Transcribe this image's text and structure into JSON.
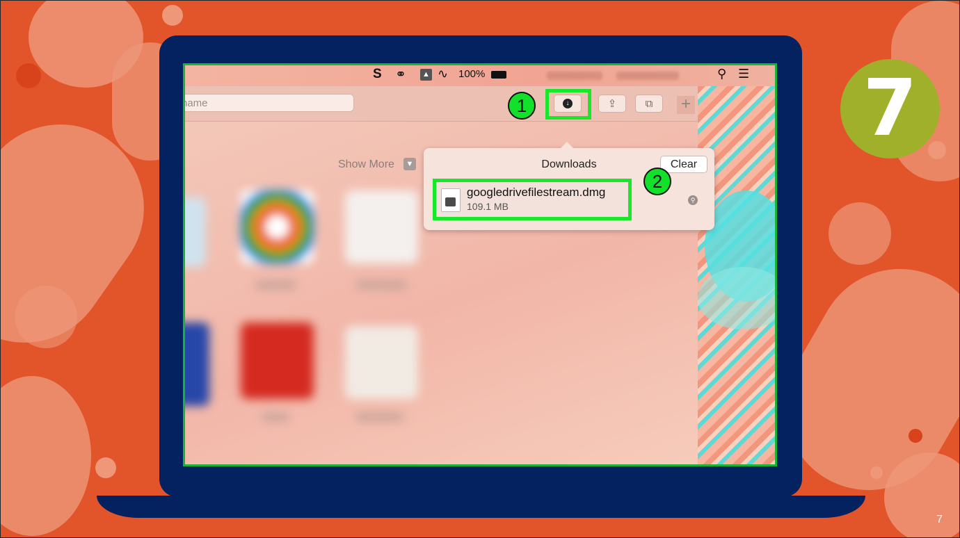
{
  "slide": {
    "step_number": "7",
    "page_number": "7",
    "colors": {
      "background": "#e2542a",
      "laptop": "#03225f",
      "highlight": "#17e82a",
      "step_badge": "#a0b02a"
    }
  },
  "menubar": {
    "icons": [
      "scribble-s-icon",
      "creative-cloud-icon",
      "google-drive-icon",
      "wifi-icon",
      "battery-icon",
      "search-icon",
      "list-icon"
    ],
    "battery_label": "100%"
  },
  "browser": {
    "address_placeholder": "name",
    "show_more_label": "Show More",
    "toolbar_icons": [
      "download-icon",
      "share-icon",
      "tabs-icon",
      "plus-icon"
    ]
  },
  "downloads": {
    "title": "Downloads",
    "clear_label": "Clear",
    "items": [
      {
        "name": "googledrivefilestream.dmg",
        "size": "109.1 MB"
      }
    ]
  },
  "callouts": {
    "one": "1",
    "two": "2"
  }
}
